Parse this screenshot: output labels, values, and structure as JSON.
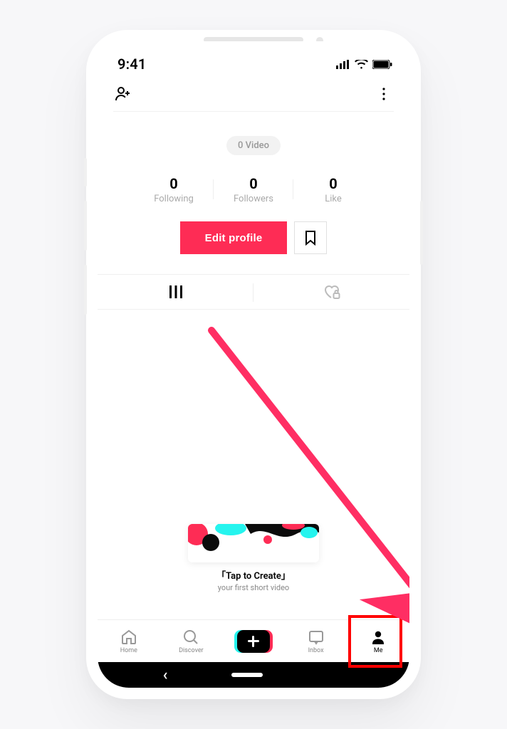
{
  "status": {
    "time": "9:41"
  },
  "profile": {
    "video_badge": "0 Video",
    "stats": {
      "following": {
        "count": "0",
        "label": "Following"
      },
      "followers": {
        "count": "0",
        "label": "Followers"
      },
      "like": {
        "count": "0",
        "label": "Like"
      }
    },
    "edit_button": "Edit profile"
  },
  "create_prompt": {
    "title": "「Tap to Create」",
    "subtitle": "your first short video"
  },
  "nav": {
    "home": "Home",
    "discover": "Discover",
    "inbox": "Inbox",
    "me": "Me"
  }
}
